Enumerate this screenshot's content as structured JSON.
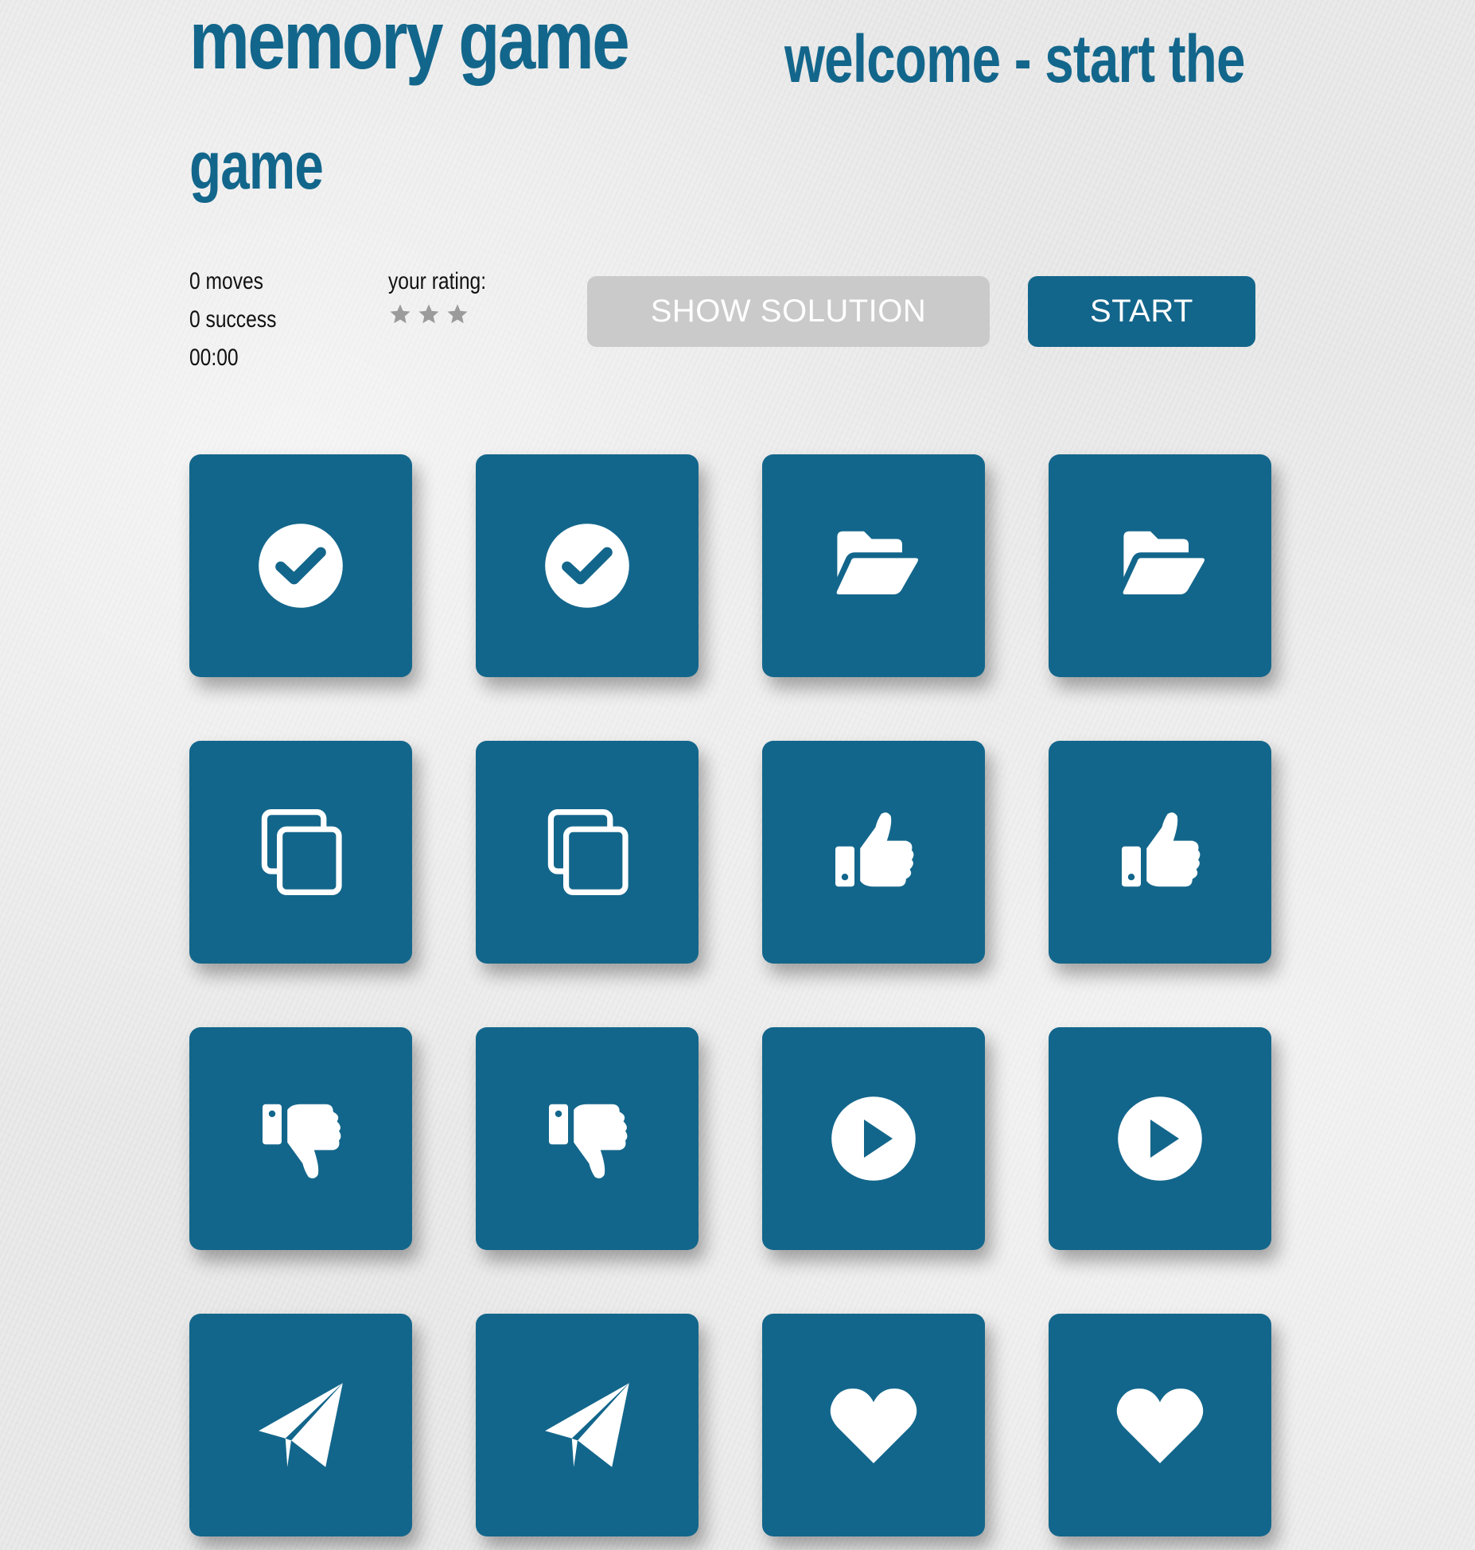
{
  "header": {
    "title": "memory game",
    "welcome_line1": "welcome - start the",
    "welcome_line2": "game"
  },
  "stats": {
    "moves": "0 moves",
    "success": "0 success",
    "timer": "00:00"
  },
  "rating": {
    "label": "your rating:",
    "stars_total": 3,
    "stars_filled": 0
  },
  "buttons": {
    "show_solution": "SHOW SOLUTION",
    "start": "START"
  },
  "colors": {
    "primary": "#13668b",
    "disabled_button": "#cacaca",
    "star_color": "#9b9b9b",
    "icon_color": "#ffffff"
  },
  "cards": [
    {
      "icon": "check-circle-icon"
    },
    {
      "icon": "check-circle-icon"
    },
    {
      "icon": "folder-open-icon"
    },
    {
      "icon": "folder-open-icon"
    },
    {
      "icon": "copy-icon"
    },
    {
      "icon": "copy-icon"
    },
    {
      "icon": "thumbs-up-icon"
    },
    {
      "icon": "thumbs-up-icon"
    },
    {
      "icon": "thumbs-down-icon"
    },
    {
      "icon": "thumbs-down-icon"
    },
    {
      "icon": "play-circle-icon"
    },
    {
      "icon": "play-circle-icon"
    },
    {
      "icon": "paper-plane-icon"
    },
    {
      "icon": "paper-plane-icon"
    },
    {
      "icon": "heart-icon"
    },
    {
      "icon": "heart-icon"
    }
  ]
}
